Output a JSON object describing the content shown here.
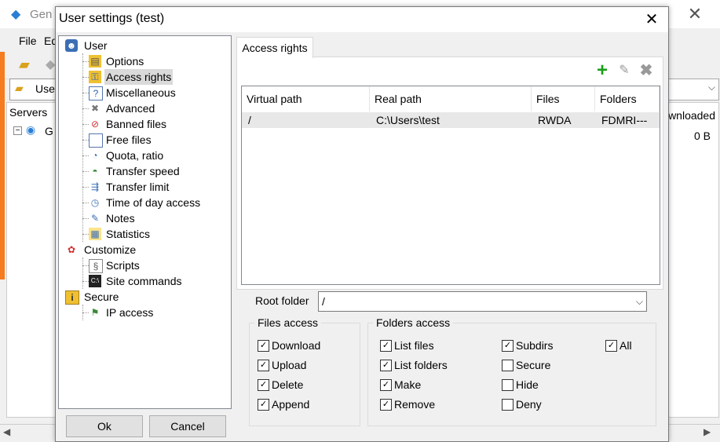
{
  "background_app": {
    "title": "Gen",
    "menu": [
      "File",
      "Ed"
    ],
    "combo_text": "Use",
    "servers_label": "Servers",
    "server_node": "G",
    "right_column_header": "wnloaded",
    "right_column_value": "0 B"
  },
  "dialog": {
    "title": "User settings (test)",
    "close_glyph": "✕",
    "ok_label": "Ok",
    "cancel_label": "Cancel"
  },
  "tree": {
    "user": "User",
    "options": "Options",
    "access_rights": "Access rights",
    "miscellaneous": "Miscellaneous",
    "advanced": "Advanced",
    "banned_files": "Banned files",
    "free_files": "Free files",
    "quota_ratio": "Quota, ratio",
    "transfer_speed": "Transfer speed",
    "transfer_limit": "Transfer limit",
    "time_of_day_access": "Time of day access",
    "notes": "Notes",
    "statistics": "Statistics",
    "customize": "Customize",
    "scripts": "Scripts",
    "site_commands": "Site commands",
    "secure": "Secure",
    "ip_access": "IP access"
  },
  "tab": {
    "label": "Access rights"
  },
  "toolbar": {
    "add_icon": "plus-icon",
    "edit_icon": "pencil-icon",
    "delete_icon": "x-icon"
  },
  "list": {
    "columns": [
      "Virtual path",
      "Real path",
      "Files",
      "Folders"
    ],
    "rows": [
      {
        "virtual_path": "/",
        "real_path": "C:\\Users\\test",
        "files": "RWDA",
        "folders": "FDMRI---"
      }
    ]
  },
  "root_folder": {
    "label": "Root folder",
    "value": "/"
  },
  "files_access": {
    "title": "Files access",
    "download": "Download",
    "upload": "Upload",
    "delete": "Delete",
    "append": "Append"
  },
  "folders_access": {
    "title": "Folders access",
    "list_files": "List files",
    "list_folders": "List folders",
    "make": "Make",
    "remove": "Remove",
    "subdirs": "Subdirs",
    "secure": "Secure",
    "hide": "Hide",
    "deny": "Deny",
    "all": "All"
  },
  "checkbox_states": {
    "download": true,
    "upload": true,
    "delete": true,
    "append": true,
    "list_files": true,
    "list_folders": true,
    "make": true,
    "remove": true,
    "subdirs": true,
    "secure": false,
    "hide": false,
    "deny": false,
    "all": true
  },
  "colors": {
    "accent_add": "#1a9c1a",
    "selection": "#dadada",
    "app_accent": "#f57c1f"
  }
}
